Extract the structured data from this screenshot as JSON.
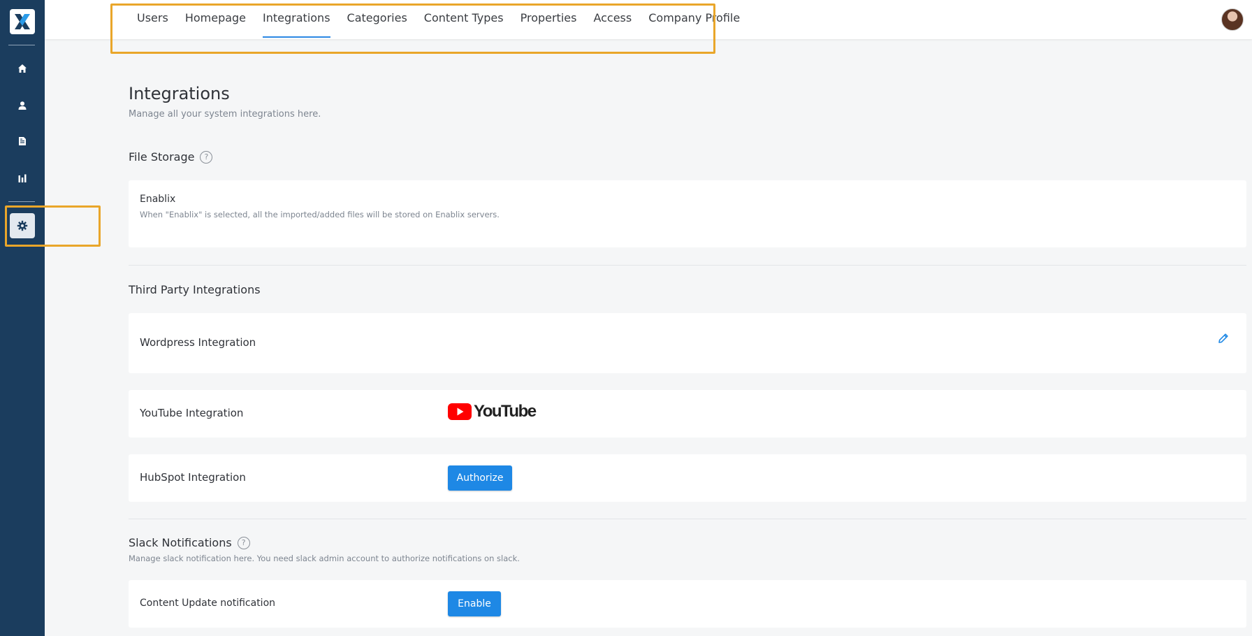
{
  "topnav": {
    "tabs": [
      {
        "label": "Users",
        "active": false
      },
      {
        "label": "Homepage",
        "active": false
      },
      {
        "label": "Integrations",
        "active": true
      },
      {
        "label": "Categories",
        "active": false
      },
      {
        "label": "Content Types",
        "active": false
      },
      {
        "label": "Properties",
        "active": false
      },
      {
        "label": "Access",
        "active": false
      },
      {
        "label": "Company Profile",
        "active": false
      }
    ]
  },
  "sidebar": {
    "items": [
      "home-icon",
      "user-icon",
      "document-icon",
      "bar-chart-icon",
      "gear-icon"
    ],
    "active": "gear-icon"
  },
  "page": {
    "title": "Integrations",
    "subtitle": "Manage all your system integrations here."
  },
  "file_storage": {
    "heading": "File Storage",
    "help": "?",
    "provider": "Enablix",
    "description": "When \"Enablix\" is selected, all the imported/added files will be stored on Enablix servers."
  },
  "third_party": {
    "heading": "Third Party Integrations",
    "wordpress": "Wordpress Integration",
    "youtube": "YouTube Integration",
    "youtube_logo_text": "YouTube",
    "hubspot": "HubSpot Integration",
    "hubspot_button": "Authorize"
  },
  "slack": {
    "heading": "Slack Notifications",
    "help": "?",
    "description": "Manage slack notification here. You need slack admin account to authorize notifications on slack.",
    "content_update": "Content Update notification",
    "enable_button": "Enable"
  },
  "colors": {
    "sidebar": "#1b3d5e",
    "accent": "#1e88e5",
    "highlight": "#e9a62a",
    "youtube_red": "#ff0000"
  }
}
